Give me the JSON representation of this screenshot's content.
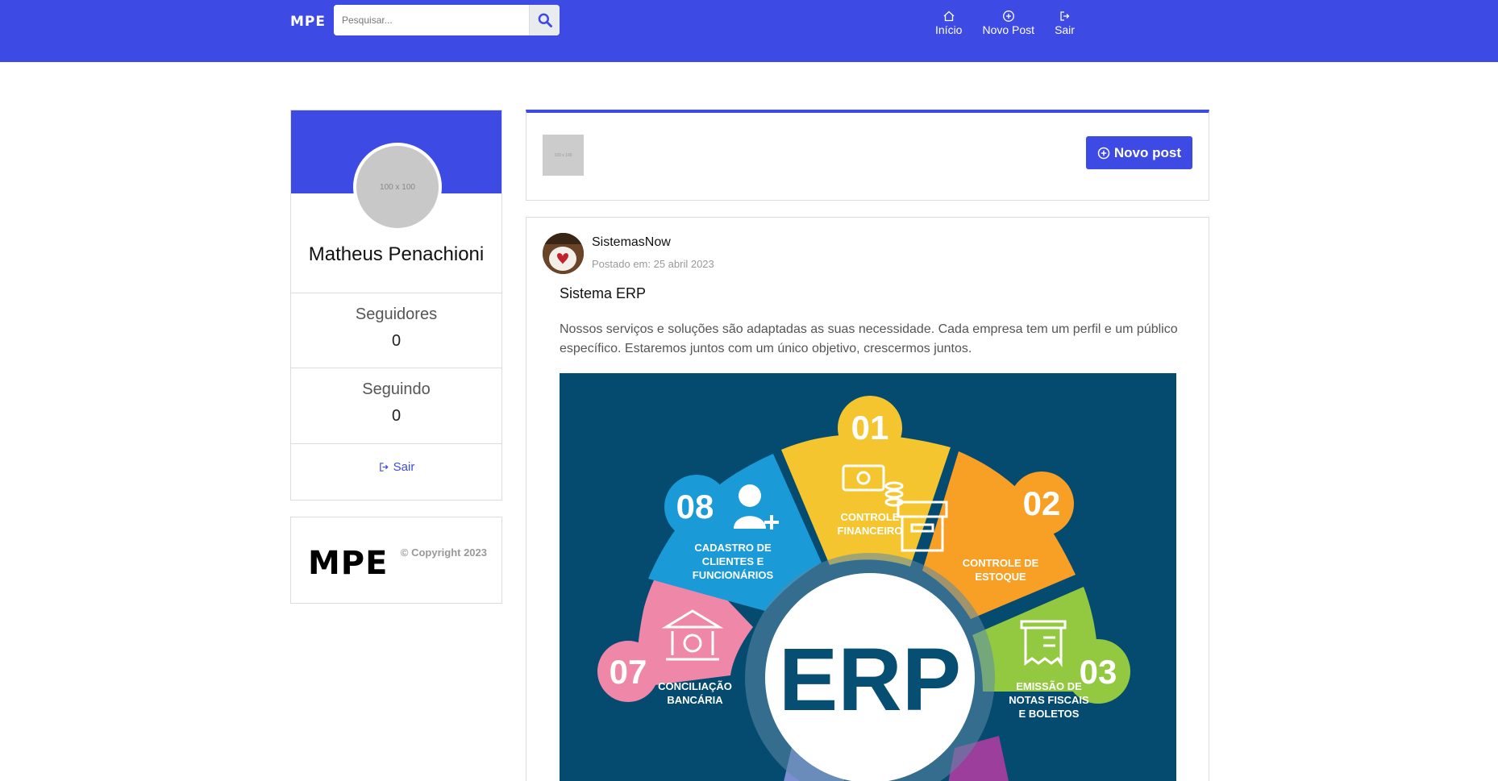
{
  "navbar": {
    "brand": "MPE",
    "search_placeholder": "Pesquisar...",
    "items": [
      {
        "label": "Início",
        "icon": "home-icon"
      },
      {
        "label": "Novo Post",
        "icon": "plus-circle-icon"
      },
      {
        "label": "Sair",
        "icon": "logout-icon"
      }
    ]
  },
  "profile": {
    "avatar_placeholder": "100 x 100",
    "name": "Matheus Penachioni",
    "followers_label": "Seguidores",
    "followers_count": "0",
    "following_label": "Seguindo",
    "following_count": "0",
    "logout_label": "Sair"
  },
  "footer": {
    "logo": "MPE",
    "copyright": "© Copyright 2023"
  },
  "new_post": {
    "thumb_placeholder": "100 x 100",
    "button_label": "Novo post"
  },
  "post": {
    "author": "SistemasNow",
    "date": "Postado em: 25 abril 2023",
    "title": "Sistema ERP",
    "text": "Nossos serviços e soluções são adaptadas as suas necessidade. Cada empresa tem um perfil e um público específico. Estaremos juntos com um único objetivo, crescermos juntos.",
    "image": {
      "center_label": "ERP",
      "segments": [
        {
          "number": "01",
          "label_lines": [
            "CONTROLE",
            "FINANCEIRO"
          ],
          "color": "#f5c02c"
        },
        {
          "number": "02",
          "label_lines": [
            "CONTROLE DE",
            "ESTOQUE"
          ],
          "color": "#f69d22"
        },
        {
          "number": "03",
          "label_lines": [
            "EMISSÃO DE",
            "NOTAS FISCAIS",
            "E BOLETOS"
          ],
          "color": "#8dc63f"
        },
        {
          "number": "07",
          "label_lines": [
            "CONCILIAÇÃO",
            "BANCÁRIA"
          ],
          "color": "#ee7fa2"
        },
        {
          "number": "08",
          "label_lines": [
            "CADASTRO DE",
            "CLIENTES E",
            "FUNCIONÁRIOS"
          ],
          "color": "#1a9ad6"
        }
      ]
    }
  },
  "colors": {
    "primary": "#3d4ae4",
    "image_bg": "#054a6f"
  }
}
